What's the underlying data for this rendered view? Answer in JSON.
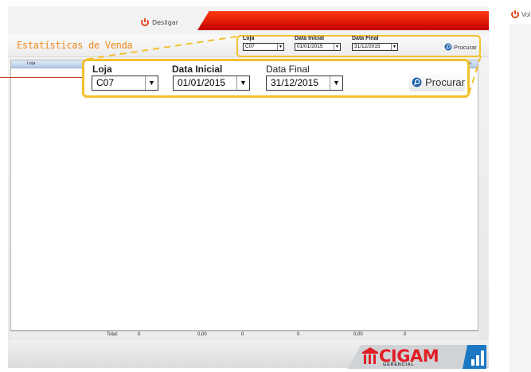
{
  "header": {
    "logout_label": "Desligar",
    "back_label": "Vol",
    "page_title": "Estatísticas de Venda"
  },
  "filters": {
    "store_label": "Loja",
    "store_value": "C07",
    "start_label": "Data Inicial",
    "start_value": "01/01/2015",
    "end_label": "Data Final",
    "end_value": "31/12/2015",
    "search_label": "Procurar"
  },
  "grid": {
    "columns": [
      "Loja",
      "da"
    ]
  },
  "totals": {
    "label": "Total:",
    "values": [
      "0",
      "0,00",
      "0",
      "0",
      "0,00",
      "0"
    ]
  },
  "brand": {
    "name": "CIGAM",
    "tagline": "GERENCIAL"
  },
  "colors": {
    "accent_red": "#e21e26",
    "title_orange": "#f08a1c",
    "highlight_yellow": "#f2c12e"
  },
  "icons": {
    "logout": "power-icon",
    "back": "power-icon",
    "search": "magnifier-icon",
    "brand_chart": "bar-chart-icon"
  }
}
